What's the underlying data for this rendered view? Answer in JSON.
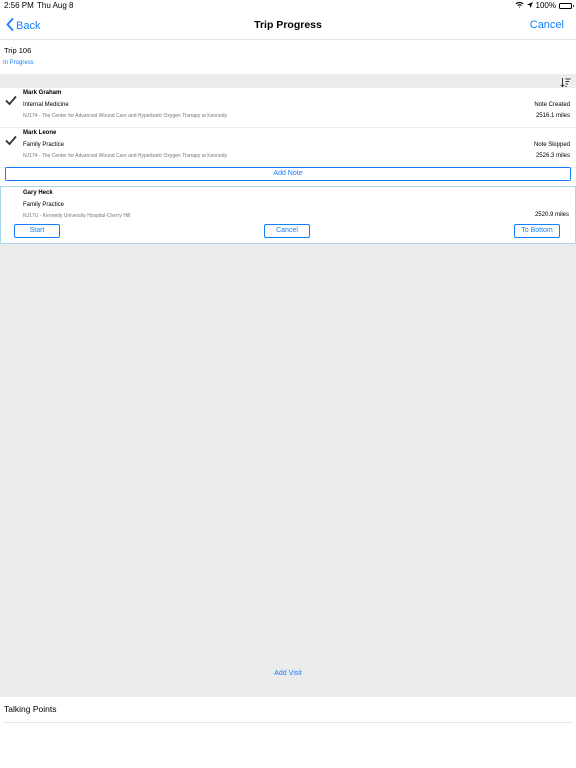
{
  "status_bar": {
    "time": "2:56 PM",
    "date": "Thu Aug 8",
    "battery": "100%"
  },
  "nav": {
    "back_label": "Back",
    "title": "Trip Progress",
    "cancel_label": "Cancel"
  },
  "trip": {
    "name": "Trip 106",
    "status": "In Progress"
  },
  "visits": [
    {
      "name": "Mark Graham",
      "specialty": "Internal Medicine",
      "location": "NJ174 - The Center for Advanced Wound Care and Hyperbaric Oxygen Therapy at Kennedy",
      "status": "Note Created",
      "distance": "2516.1 miles"
    },
    {
      "name": "Mark Leone",
      "specialty": "Family Practice",
      "location": "NJ174 - The Center for Advanced Wound Care and Hyperbaric Oxygen Therapy at Kennedy",
      "status": "Note Skipped",
      "distance": "2526.3 miles"
    }
  ],
  "add_note_label": "Add Note",
  "active_visit": {
    "name": "Gary Heck",
    "specialty": "Family Practice",
    "location": "NJ17U - Kennedy University Hospital-Cherry Hill",
    "distance": "2520.9 miles",
    "start_label": "Start",
    "cancel_label": "Cancel",
    "to_bottom_label": "To Bottom"
  },
  "add_visit_label": "Add Visit",
  "talking_points": {
    "title": "Talking Points"
  },
  "colors": {
    "accent": "#157efb",
    "background_gray": "#ececec",
    "active_border": "#a9d8ea"
  },
  "icons": {
    "back": "chevron-left-icon",
    "wifi": "wifi-icon",
    "location": "location-arrow-icon",
    "battery": "battery-icon",
    "sort": "sort-descending-icon",
    "check": "checkmark-icon"
  }
}
